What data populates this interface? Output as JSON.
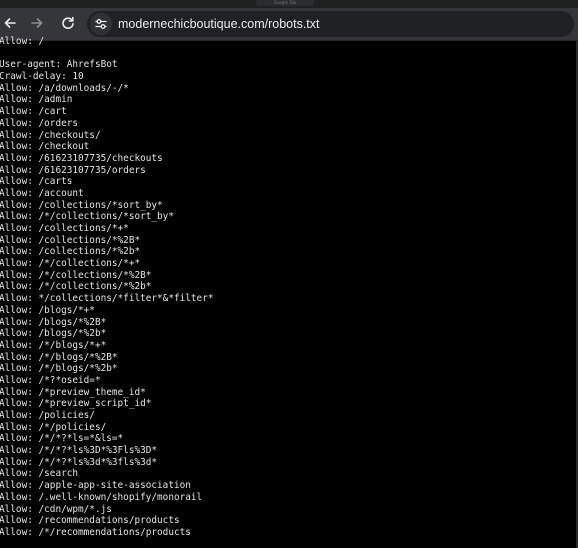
{
  "browser": {
    "tab_title": "Google Tab",
    "url": "modernechicboutique.com/robots.txt"
  },
  "robots_lines": [
    "Allow: /",
    "",
    "User-agent: AhrefsBot",
    "Crawl-delay: 10",
    "Allow: /a/downloads/-/*",
    "Allow: /admin",
    "Allow: /cart",
    "Allow: /orders",
    "Allow: /checkouts/",
    "Allow: /checkout",
    "Allow: /61623107735/checkouts",
    "Allow: /61623107735/orders",
    "Allow: /carts",
    "Allow: /account",
    "Allow: /collections/*sort_by*",
    "Allow: /*/collections/*sort_by*",
    "Allow: /collections/*+*",
    "Allow: /collections/*%2B*",
    "Allow: /collections/*%2b*",
    "Allow: /*/collections/*+*",
    "Allow: /*/collections/*%2B*",
    "Allow: /*/collections/*%2b*",
    "Allow: */collections/*filter*&*filter*",
    "Allow: /blogs/*+*",
    "Allow: /blogs/*%2B*",
    "Allow: /blogs/*%2b*",
    "Allow: /*/blogs/*+*",
    "Allow: /*/blogs/*%2B*",
    "Allow: /*/blogs/*%2b*",
    "Allow: /*?*oseid=*",
    "Allow: /*preview_theme_id*",
    "Allow: /*preview_script_id*",
    "Allow: /policies/",
    "Allow: /*/policies/",
    "Allow: /*/*?*ls=*&ls=*",
    "Allow: /*/*?*ls%3D*%3Fls%3D*",
    "Allow: /*/*?*ls%3d*%3fls%3d*",
    "Allow: /search",
    "Allow: /apple-app-site-association",
    "Allow: /.well-known/shopify/monorail",
    "Allow: /cdn/wpm/*.js",
    "Allow: /recommendations/products",
    "Allow: /*/recommendations/products"
  ],
  "colors": {
    "toolbar": "#35363a",
    "omnibox": "#202124",
    "page_background": "#000000",
    "text": "#e4e4e4"
  },
  "icons": {
    "back": "arrow-left-icon",
    "forward": "arrow-right-icon",
    "reload": "reload-icon",
    "site_info": "tune-icon"
  }
}
